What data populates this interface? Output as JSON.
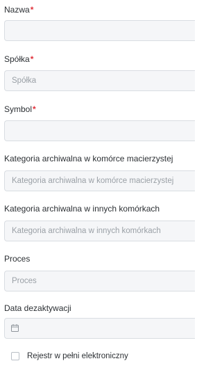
{
  "form": {
    "nazwa": {
      "label": "Nazwa",
      "required": "*",
      "value": "",
      "placeholder": ""
    },
    "spolka": {
      "label": "Spółka",
      "required": "*",
      "value": "",
      "placeholder": "Spółka"
    },
    "symbol": {
      "label": "Symbol",
      "required": "*",
      "value": "",
      "placeholder": ""
    },
    "kategoria_macierzysta": {
      "label": "Kategoria archiwalna w komórce macierzystej",
      "value": "",
      "placeholder": "Kategoria archiwalna w komórce macierzystej"
    },
    "kategoria_inne": {
      "label": "Kategoria archiwalna w innych komórkach",
      "value": "",
      "placeholder": "Kategoria archiwalna w innych komórkach"
    },
    "proces": {
      "label": "Proces",
      "value": "",
      "placeholder": "Proces"
    },
    "data_dezaktywacji": {
      "label": "Data dezaktywacji",
      "value": "",
      "icon": "calendar-icon"
    },
    "rejestr": {
      "label": "Rejestr w pełni elektroniczny",
      "checked": false
    }
  },
  "colors": {
    "required": "#e0313b",
    "input_background": "#f5f6f8",
    "input_border": "#d9dde2",
    "placeholder": "#9aa0a6"
  }
}
